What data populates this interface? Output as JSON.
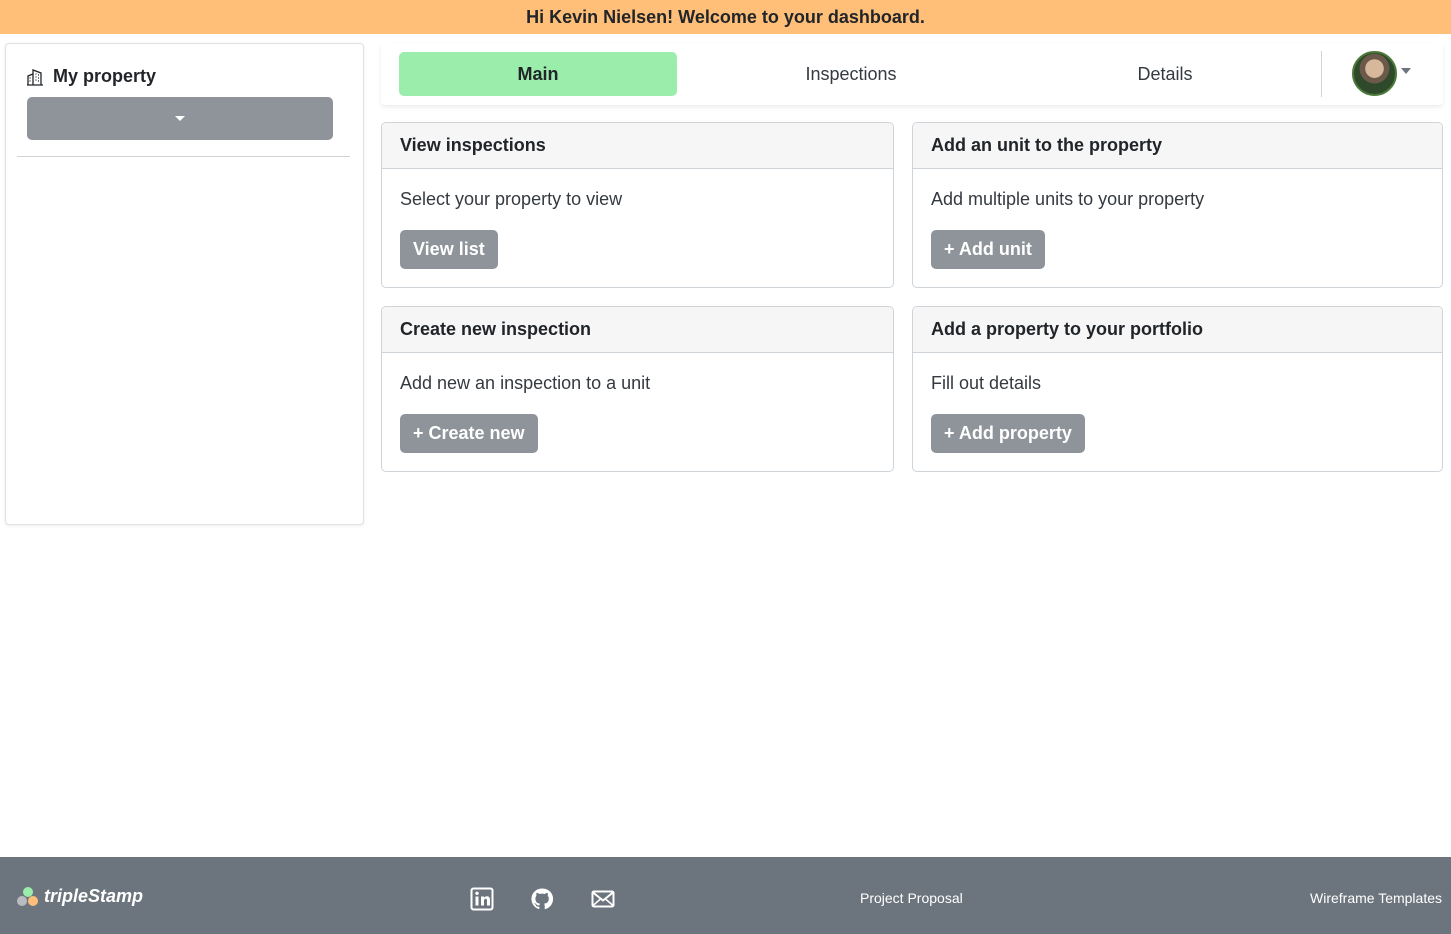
{
  "banner": {
    "text": "Hi Kevin Nielsen! Welcome to your dashboard."
  },
  "sidebar": {
    "title": "My property",
    "title_icon": "building-icon",
    "select_value": ""
  },
  "nav": {
    "tabs": [
      {
        "label": "Main",
        "active": true
      },
      {
        "label": "Inspections",
        "active": false
      },
      {
        "label": "Details",
        "active": false
      }
    ],
    "avatar_icon": "user-avatar"
  },
  "cards": [
    {
      "title": "View inspections",
      "text": "Select your property to view",
      "button": "View list"
    },
    {
      "title": "Add an unit to the property",
      "text": "Add multiple units to your property",
      "button": "+ Add unit"
    },
    {
      "title": "Create new inspection",
      "text": "Add new an inspection to a unit",
      "button": "+ Create new"
    },
    {
      "title": "Add a property to your portfolio",
      "text": "Fill out details",
      "button": "+ Add property"
    }
  ],
  "footer": {
    "brand": "tripleStamp",
    "social_icons": [
      "linkedin-icon",
      "github-icon",
      "mail-icon"
    ],
    "links": [
      "Project Proposal",
      "Wireframe Templates"
    ]
  },
  "colors": {
    "banner_bg": "#ffbf78",
    "active_tab": "#9aedaa",
    "button_gray": "#8f949a",
    "footer_bg": "#6c757d"
  }
}
